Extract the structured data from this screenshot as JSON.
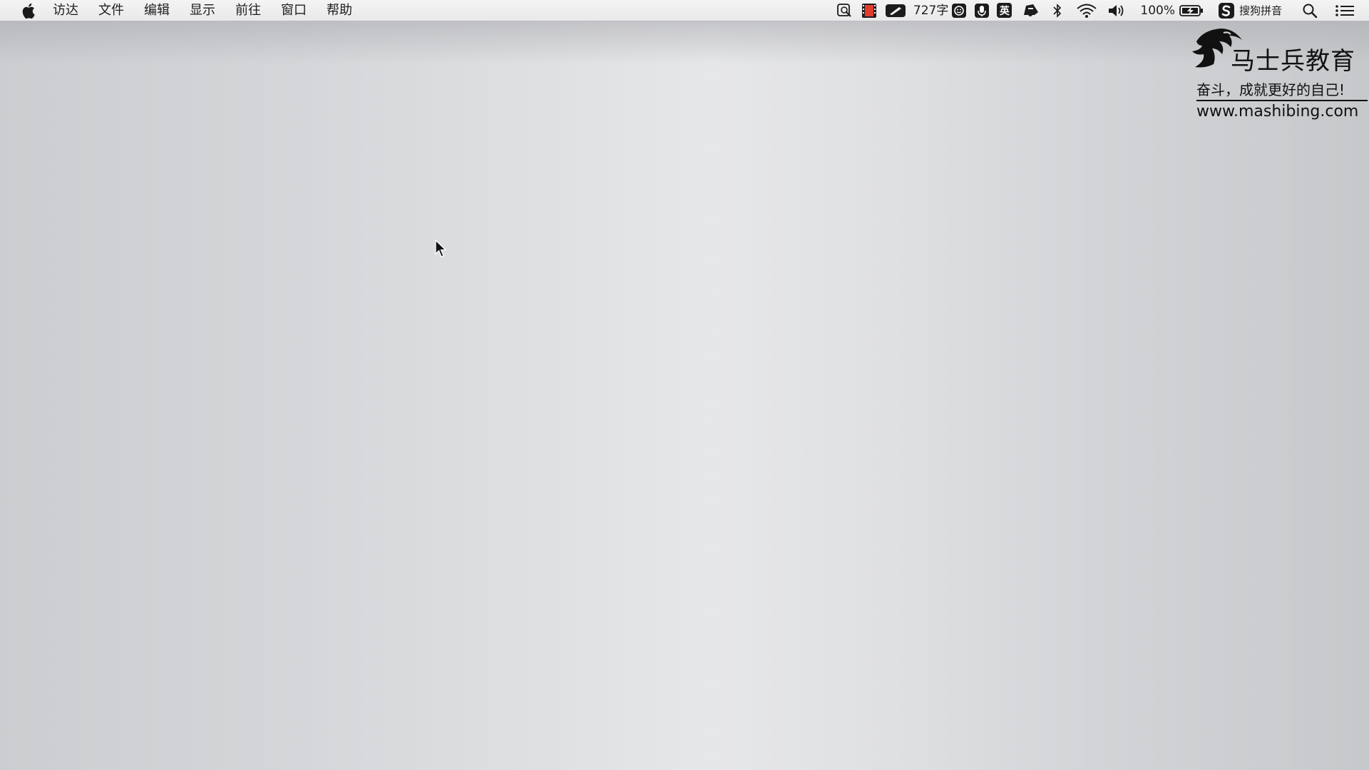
{
  "menubar": {
    "apple_icon": "apple-logo-icon",
    "items": [
      {
        "label": "访达"
      },
      {
        "label": "文件"
      },
      {
        "label": "编辑"
      },
      {
        "label": "显示"
      },
      {
        "label": "前往"
      },
      {
        "label": "窗口"
      },
      {
        "label": "帮助"
      }
    ]
  },
  "tray": {
    "word_count": "727字",
    "input_mode": "英",
    "battery_percent": "100%",
    "input_method": "搜狗拼音",
    "icons": [
      "screenshot-search-icon",
      "record-icon",
      "pen-icon",
      "emoji-icon",
      "microphone-icon",
      "input-mode-icon",
      "notification-icon",
      "bluetooth-icon",
      "wifi-icon",
      "volume-icon",
      "battery-charging-icon",
      "sogou-icon",
      "spotlight-search-icon",
      "notification-center-icon"
    ]
  },
  "watermark": {
    "title": "马士兵教育",
    "slogan": "奋斗，成就更好的自己!",
    "url": "www.mashibing.com"
  },
  "colors": {
    "menubar_bg": "#eeeeee",
    "desktop_bg": "#dfe0e2",
    "record_red": "#e23b2e"
  }
}
